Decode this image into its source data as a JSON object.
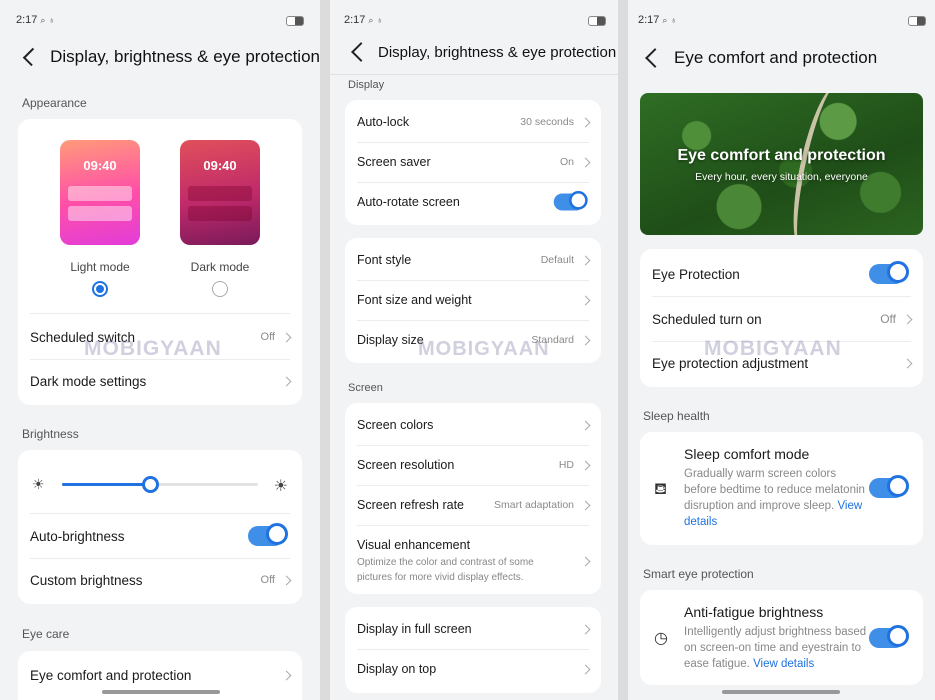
{
  "status": {
    "time": "2:17"
  },
  "watermark": "MOBIGYAAN",
  "screen1": {
    "title": "Display, brightness & eye protection",
    "appearance_label": "Appearance",
    "light_mode": {
      "clock": "09:40",
      "label": "Light mode"
    },
    "dark_mode": {
      "clock": "09:40",
      "label": "Dark mode"
    },
    "scheduled_switch": {
      "label": "Scheduled switch",
      "value": "Off"
    },
    "dark_mode_settings": {
      "label": "Dark mode settings"
    },
    "brightness_label": "Brightness",
    "brightness_level": 0.45,
    "auto_brightness": {
      "label": "Auto-brightness",
      "on": true
    },
    "custom_brightness": {
      "label": "Custom brightness",
      "value": "Off"
    },
    "eye_care_label": "Eye care",
    "eye_comfort": {
      "label": "Eye comfort and protection"
    }
  },
  "screen2": {
    "title": "Display, brightness & eye protection",
    "display_label": "Display",
    "auto_lock": {
      "label": "Auto-lock",
      "value": "30 seconds"
    },
    "screen_saver": {
      "label": "Screen saver",
      "value": "On"
    },
    "auto_rotate": {
      "label": "Auto-rotate screen",
      "on": true
    },
    "font_style": {
      "label": "Font style",
      "value": "Default"
    },
    "font_size": {
      "label": "Font size and weight"
    },
    "display_size": {
      "label": "Display size",
      "value": "Standard"
    },
    "screen_label": "Screen",
    "screen_colors": {
      "label": "Screen colors"
    },
    "screen_resolution": {
      "label": "Screen resolution",
      "value": "HD"
    },
    "refresh_rate": {
      "label": "Screen refresh rate",
      "value": "Smart adaptation"
    },
    "visual_enhancement": {
      "label": "Visual enhancement",
      "desc": "Optimize the color and contrast of some pictures for more vivid display effects."
    },
    "full_screen": {
      "label": "Display in full screen"
    },
    "on_top": {
      "label": "Display on top"
    }
  },
  "screen3": {
    "title": "Eye comfort and protection",
    "banner_title": "Eye comfort and protection",
    "banner_subtitle": "Every hour, every situation, everyone",
    "eye_protection": {
      "label": "Eye Protection",
      "on": true
    },
    "scheduled_turn_on": {
      "label": "Scheduled turn on",
      "value": "Off"
    },
    "eye_adjustment": {
      "label": "Eye protection adjustment"
    },
    "sleep_health_label": "Sleep health",
    "sleep_comfort": {
      "label": "Sleep comfort mode",
      "desc": "Gradually warm screen colors before bedtime to reduce melatonin disruption and improve sleep.",
      "link": "View details",
      "on": true
    },
    "smart_eye_label": "Smart eye protection",
    "anti_fatigue": {
      "label": "Anti-fatigue brightness",
      "desc": "Intelligently adjust brightness based on screen-on time and eyestrain to ease fatigue.",
      "link": "View details",
      "on": true
    }
  }
}
